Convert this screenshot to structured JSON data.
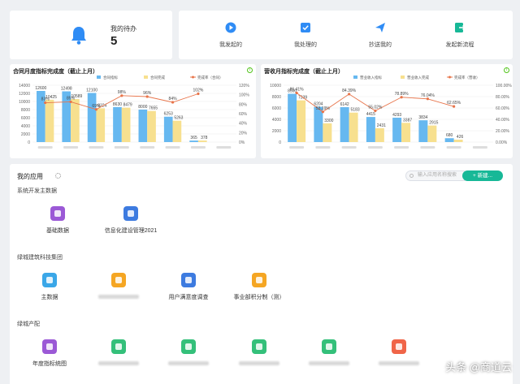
{
  "todo": {
    "label": "我的待办",
    "count": "5"
  },
  "quick_actions": [
    {
      "label": "我发起的",
      "icon": "play-circle-icon"
    },
    {
      "label": "我处理的",
      "icon": "check-square-icon"
    },
    {
      "label": "抄送我的",
      "icon": "send-icon"
    },
    {
      "label": "发起新流程",
      "icon": "exit-icon"
    }
  ],
  "colors": {
    "accent": "#1890ff",
    "bar_plan": "#66b8f0",
    "bar_done": "#f7e08f",
    "line": "#e8744a",
    "primary_btn": "#17b897"
  },
  "chart_data": [
    {
      "type": "bar",
      "title": "合同月度指标完成度（截止上月）",
      "legend": [
        "合同指标",
        "合同完成",
        "完成率（合同）"
      ],
      "categories": [
        "",
        "",
        "",
        "",
        "",
        "",
        "",
        ""
      ],
      "series": [
        {
          "name": "合同指标",
          "values": [
            12600,
            12498,
            12100,
            8630,
            8000,
            6253,
            365,
            0
          ]
        },
        {
          "name": "合同完成",
          "values": [
            10425,
            10589,
            8324,
            8479,
            7655,
            5263,
            378,
            0
          ]
        },
        {
          "name": "完成率（合同）",
          "values": [
            83,
            85,
            69,
            98,
            96,
            84,
            102,
            0
          ]
        }
      ],
      "ylim": [
        0,
        14000
      ],
      "y_ticks": [
        "14000",
        "12000",
        "10000",
        "8000",
        "6000",
        "4000",
        "2000",
        "0"
      ],
      "y2_ticks": [
        "120%",
        "100%",
        "80%",
        "60%",
        "40%",
        "20%",
        "0%"
      ],
      "bar_labels": [
        "12600",
        "10425",
        "12498",
        "10589",
        "12100",
        "8324",
        "8630",
        "8479",
        "8000",
        "7655",
        "6253",
        "5263",
        "365",
        "378"
      ],
      "line_labels": [
        "83%",
        "85%",
        "69%",
        "98%",
        "96%",
        "84%",
        "102%"
      ]
    },
    {
      "type": "bar",
      "title": "营收月指标完成度（截止上月）",
      "legend": [
        "营业收入指标",
        "营业收入完成",
        "完成率（营收）"
      ],
      "categories": [
        "",
        "",
        "",
        "",
        "",
        "",
        "",
        ""
      ],
      "series": [
        {
          "name": "营业收入指标",
          "values": [
            8500,
            6204,
            6142,
            4415,
            4293,
            3834,
            680,
            0
          ]
        },
        {
          "name": "营业收入完成",
          "values": [
            7339,
            3300,
            5183,
            2431,
            3387,
            2915,
            426,
            0
          ]
        },
        {
          "name": "完成率（营收）",
          "values": [
            86.41,
            53.19,
            84.39,
            55.02,
            78.89,
            76.04,
            62.65,
            0
          ]
        }
      ],
      "ylim": [
        0,
        10000
      ],
      "y_ticks": [
        "10000",
        "8000",
        "6000",
        "4000",
        "2000",
        "0"
      ],
      "y2_ticks": [
        "100.00%",
        "80.00%",
        "60.00%",
        "40.00%",
        "20.00%",
        "0.00%"
      ],
      "bar_labels": [
        "7339",
        "6204",
        "3300",
        "6142",
        "5183",
        "4415",
        "2431",
        "4293",
        "3387",
        "3834",
        "2915",
        "680",
        "426"
      ],
      "line_labels": [
        "86.41%",
        "53.19%",
        "84.39%",
        "55.02%",
        "78.89%",
        "76.04%",
        "62.65%"
      ]
    }
  ],
  "apps": {
    "title": "我的应用",
    "search_placeholder": "输入应用名称搜索",
    "new_button": "+ 新建...",
    "sections": [
      {
        "title": "系统开发主数据",
        "items": [
          {
            "label": "基础数据",
            "color": "#9b59d6"
          },
          {
            "label": "信息化建设管理2021",
            "color": "#3d7be0"
          }
        ]
      },
      {
        "title": "绿城建筑科技集团",
        "items": [
          {
            "label": "主数据",
            "color": "#3aa7e8"
          },
          {
            "label": "",
            "color": "#f5a623"
          },
          {
            "label": "用户满意度调查",
            "color": "#3d7be0"
          },
          {
            "label": "事业部积分制（测）",
            "color": "#f5a623"
          }
        ]
      },
      {
        "title": "绿城产配",
        "items": [
          {
            "label": "年度指标统图",
            "color": "#9b59d6"
          },
          {
            "label": "",
            "color": "#34c07a"
          },
          {
            "label": "",
            "color": "#34c07a"
          },
          {
            "label": "",
            "color": "#34c07a"
          },
          {
            "label": "",
            "color": "#34c07a"
          },
          {
            "label": "",
            "color": "#f06548"
          }
        ]
      }
    ]
  },
  "watermark": "头条 @商道云"
}
